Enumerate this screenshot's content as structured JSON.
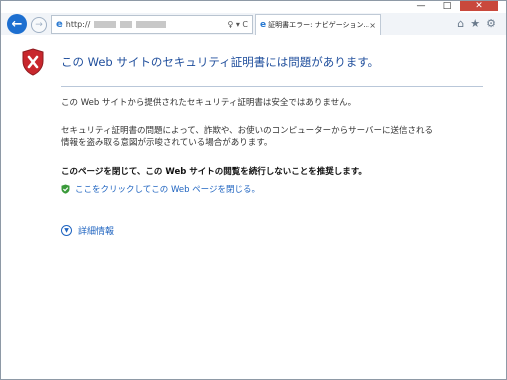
{
  "window": {
    "controls": {
      "minimize": "—",
      "maximize": "□",
      "close": "✕"
    }
  },
  "toolbar": {
    "back_icon": "←",
    "forward_icon": "→",
    "address_text": "http://",
    "address_controls": "♀ ▾ C",
    "tab": {
      "label": "証明書エラー: ナビゲーション...",
      "close": "×"
    },
    "right_icons": {
      "home": "⌂",
      "favorites": "★",
      "tools": "⚙"
    }
  },
  "content": {
    "title": "この Web サイトのセキュリティ証明書には問題があります。",
    "paragraph1": "この Web サイトから提供されたセキュリティ証明書は安全ではありません。",
    "paragraph2": "セキュリティ証明書の問題によって、詐欺や、お使いのコンピューターからサーバーに送信される情報を盗み取る意図が示唆されている場合があります。",
    "recommendation": "このページを閉じて、この Web サイトの閲覧を続行しないことを推奨します。",
    "close_link": "ここをクリックしてこの Web ページを閉じる。",
    "details_link": "詳細情報"
  },
  "colors": {
    "title": "#1f4e9c",
    "link": "#1f64c0",
    "shield_red": "#c8272d",
    "close_button": "#c9483c"
  },
  "icons": {
    "shield": "shield-error-icon",
    "check": "green-check-shield-icon",
    "expand": "circle-chevron-down-icon"
  }
}
